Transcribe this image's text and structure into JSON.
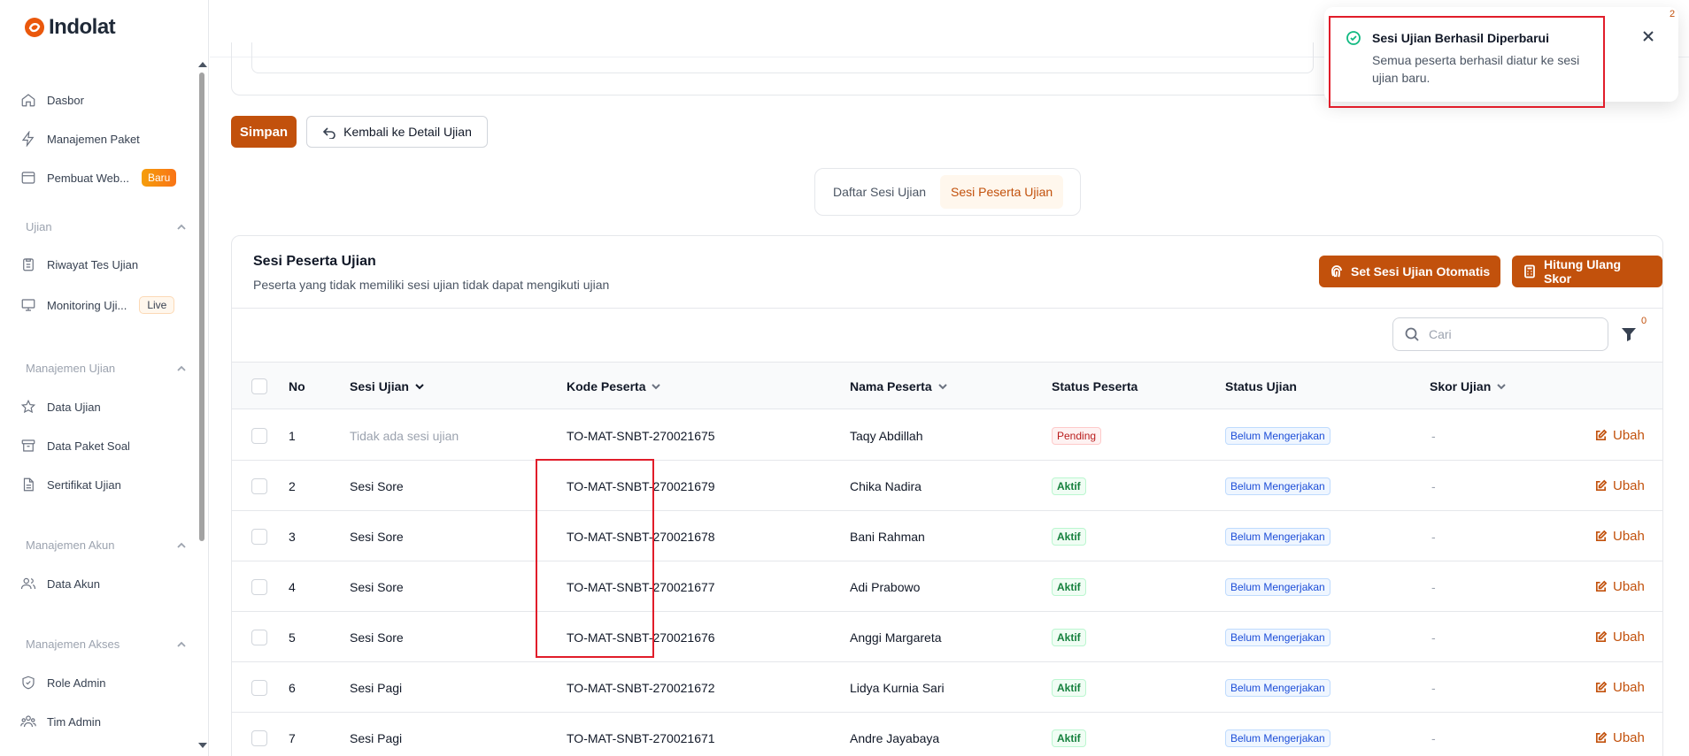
{
  "app": {
    "brand": "Indolat"
  },
  "colors": {
    "primary": "#c2510c",
    "highlight": "#e11d2a",
    "success": "#10b981"
  },
  "sidebar": {
    "items": [
      {
        "label": "Dasbor",
        "icon": "home-icon"
      },
      {
        "label": "Manajemen Paket",
        "icon": "bolt-icon"
      },
      {
        "label": "Pembuat Web...",
        "icon": "browser-icon",
        "badge": "Baru"
      }
    ],
    "sections": [
      {
        "title": "Ujian",
        "items": [
          {
            "label": "Riwayat Tes Ujian",
            "icon": "clipboard-icon"
          },
          {
            "label": "Monitoring Uji...",
            "icon": "monitor-icon",
            "badge": "Live"
          }
        ]
      },
      {
        "title": "Manajemen Ujian",
        "items": [
          {
            "label": "Data Ujian",
            "icon": "star-icon"
          },
          {
            "label": "Data Paket Soal",
            "icon": "archive-icon"
          },
          {
            "label": "Sertifikat Ujian",
            "icon": "document-icon"
          }
        ]
      },
      {
        "title": "Manajemen Akun",
        "items": [
          {
            "label": "Data Akun",
            "icon": "users-icon"
          }
        ]
      },
      {
        "title": "Manajemen Akses",
        "items": [
          {
            "label": "Role Admin",
            "icon": "shield-icon"
          },
          {
            "label": "Tim Admin",
            "icon": "team-icon"
          }
        ]
      }
    ]
  },
  "actions": {
    "save": "Simpan",
    "back": "Kembali ke Detail Ujian"
  },
  "tabs": [
    {
      "label": "Daftar Sesi Ujian",
      "active": false
    },
    {
      "label": "Sesi Peserta Ujian",
      "active": true
    }
  ],
  "panel": {
    "title": "Sesi Peserta Ujian",
    "subtitle": "Peserta yang tidak memiliki sesi ujian tidak dapat mengikuti ujian",
    "auto_button": "Set Sesi Ujian Otomatis",
    "recalc_button": "Hitung Ulang Skor",
    "search_placeholder": "Cari",
    "filter_count": "0"
  },
  "table": {
    "columns": {
      "no": "No",
      "sesi": "Sesi Ujian",
      "kode": "Kode Peserta",
      "nama": "Nama Peserta",
      "status_peserta": "Status Peserta",
      "status_ujian": "Status Ujian",
      "skor": "Skor Ujian"
    },
    "edit_label": "Ubah",
    "rows": [
      {
        "no": "1",
        "sesi": "Tidak ada sesi ujian",
        "kode": "TO-MAT-SNBT-270021675",
        "nama": "Taqy Abdillah",
        "status_peserta": "Pending",
        "status_ujian": "Belum Mengerjakan",
        "skor": "-"
      },
      {
        "no": "2",
        "sesi": "Sesi Sore",
        "kode": "TO-MAT-SNBT-270021679",
        "nama": "Chika Nadira",
        "status_peserta": "Aktif",
        "status_ujian": "Belum Mengerjakan",
        "skor": "-"
      },
      {
        "no": "3",
        "sesi": "Sesi Sore",
        "kode": "TO-MAT-SNBT-270021678",
        "nama": "Bani Rahman",
        "status_peserta": "Aktif",
        "status_ujian": "Belum Mengerjakan",
        "skor": "-"
      },
      {
        "no": "4",
        "sesi": "Sesi Sore",
        "kode": "TO-MAT-SNBT-270021677",
        "nama": "Adi Prabowo",
        "status_peserta": "Aktif",
        "status_ujian": "Belum Mengerjakan",
        "skor": "-"
      },
      {
        "no": "5",
        "sesi": "Sesi Sore",
        "kode": "TO-MAT-SNBT-270021676",
        "nama": "Anggi Margareta",
        "status_peserta": "Aktif",
        "status_ujian": "Belum Mengerjakan",
        "skor": "-"
      },
      {
        "no": "6",
        "sesi": "Sesi Pagi",
        "kode": "TO-MAT-SNBT-270021672",
        "nama": "Lidya Kurnia Sari",
        "status_peserta": "Aktif",
        "status_ujian": "Belum Mengerjakan",
        "skor": "-"
      },
      {
        "no": "7",
        "sesi": "Sesi Pagi",
        "kode": "TO-MAT-SNBT-270021671",
        "nama": "Andre Jayabaya",
        "status_peserta": "Aktif",
        "status_ujian": "Belum Mengerjakan",
        "skor": "-"
      }
    ]
  },
  "toast": {
    "title": "Sesi Ujian Berhasil Diperbarui",
    "message": "Semua peserta berhasil diatur ke sesi ujian baru."
  },
  "corner_count": "2"
}
